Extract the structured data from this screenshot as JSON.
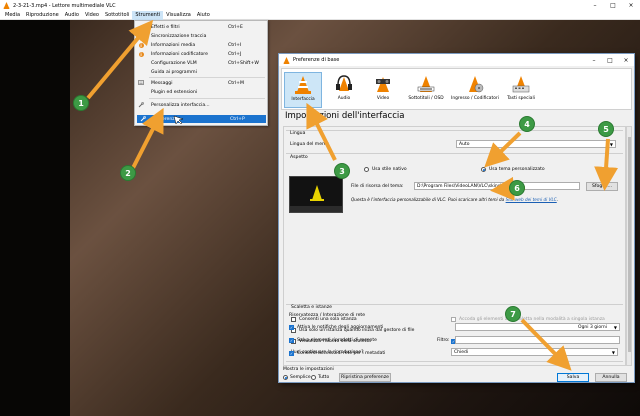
{
  "window": {
    "title": "2-3-21-3.mp4 - Lettore multimediale VLC"
  },
  "menubar": [
    "Media",
    "Riproduzione",
    "Audio",
    "Video",
    "Sottotitoli",
    "Strumenti",
    "Visualizza",
    "Aiuto"
  ],
  "dropdown": {
    "items": [
      {
        "label": "Effetti e filtri",
        "shortcut": "Ctrl+E",
        "icon": "none"
      },
      {
        "label": "Sincronizzazione traccia",
        "shortcut": "",
        "icon": "none"
      },
      {
        "label": "Informazioni media",
        "shortcut": "Ctrl+I",
        "icon": "info-icon"
      },
      {
        "label": "Informazioni codificatore",
        "shortcut": "Ctrl+J",
        "icon": "info-icon"
      },
      {
        "label": "Configurazione VLM",
        "shortcut": "Ctrl+Shift+W",
        "icon": "none"
      },
      {
        "label": "Guida ai programmi",
        "shortcut": "",
        "icon": "none"
      },
      {
        "label": "Messaggi",
        "shortcut": "Ctrl+M",
        "icon": "messages-icon"
      },
      {
        "label": "Plugin ed estensioni",
        "shortcut": "",
        "icon": "none"
      },
      {
        "label": "Personalizza interfaccia...",
        "shortcut": "",
        "icon": "wrench-icon"
      },
      {
        "label": "Preferenze",
        "shortcut": "Ctrl+P",
        "icon": "wrench-icon"
      }
    ]
  },
  "dialog": {
    "title": "Preferenze di base",
    "categories": [
      "Interfaccia",
      "Audio",
      "Video",
      "Sottotitoli / OSD",
      "Ingresso / Codificatori",
      "Tasti speciali"
    ],
    "section_title": "Impostazioni dell'interfaccia",
    "lingua": {
      "group": "Lingua",
      "label": "Lingua del menu:",
      "value": "Auto"
    },
    "aspetto": {
      "group": "Aspetto",
      "radio_native": "Usa stile nativo",
      "radio_custom": "Usa tema personalizzato",
      "skin_label": "File di risorsa del tema:",
      "skin_value": "D:\\Program Files\\VideoLAN\\VLC\\skins\\Dark.vlt",
      "browse": "Sfoglia...",
      "note": "Questa è l'interfaccia personalizzabile di VLC. Puoi scaricare altri temi da",
      "link": "Sito web dei temi di VLC",
      "note_end": "."
    },
    "scaletta": {
      "group": "Scaletta e istanze",
      "one_instance": "Consenti una sola istanza",
      "file_manager": "Usa solo un'istanza quando  inizia dal gestore di file",
      "playlist_tree": "Visualizza l'albero della scaletta",
      "continue_label": "Vuoi continuare la riproduzione?",
      "continue_value": "Chiedi",
      "enqueue": "Accoda gli elementi alla scaletta nella modalità a singola istanza",
      "pause_last": "Pausa sull'ultimo fotogramma di un video"
    },
    "privacy": {
      "group": "Riservatezza / Interazione di rete",
      "updates": "Attiva le notifiche degli aggiornamenti",
      "updates_value": "Ogni 3 giorni",
      "recent": "Salva elementi riprodotti di recente",
      "filter_label": "Filtro:",
      "metadata": "Consenti accesso di rete per i metadati"
    },
    "bottom": {
      "show_label": "Mostra le impostazioni",
      "simple": "Semplice",
      "all": "Tutto",
      "reset": "Ripristina preferenze",
      "save": "Salva",
      "cancel": "Annulla"
    }
  },
  "callouts": [
    "1",
    "2",
    "3",
    "4",
    "5",
    "6",
    "7"
  ],
  "colors": {
    "callout": "#3d9a45",
    "arrow": "#f0a030",
    "selection": "#1b73ce",
    "vlc_orange": "#ef8200"
  }
}
